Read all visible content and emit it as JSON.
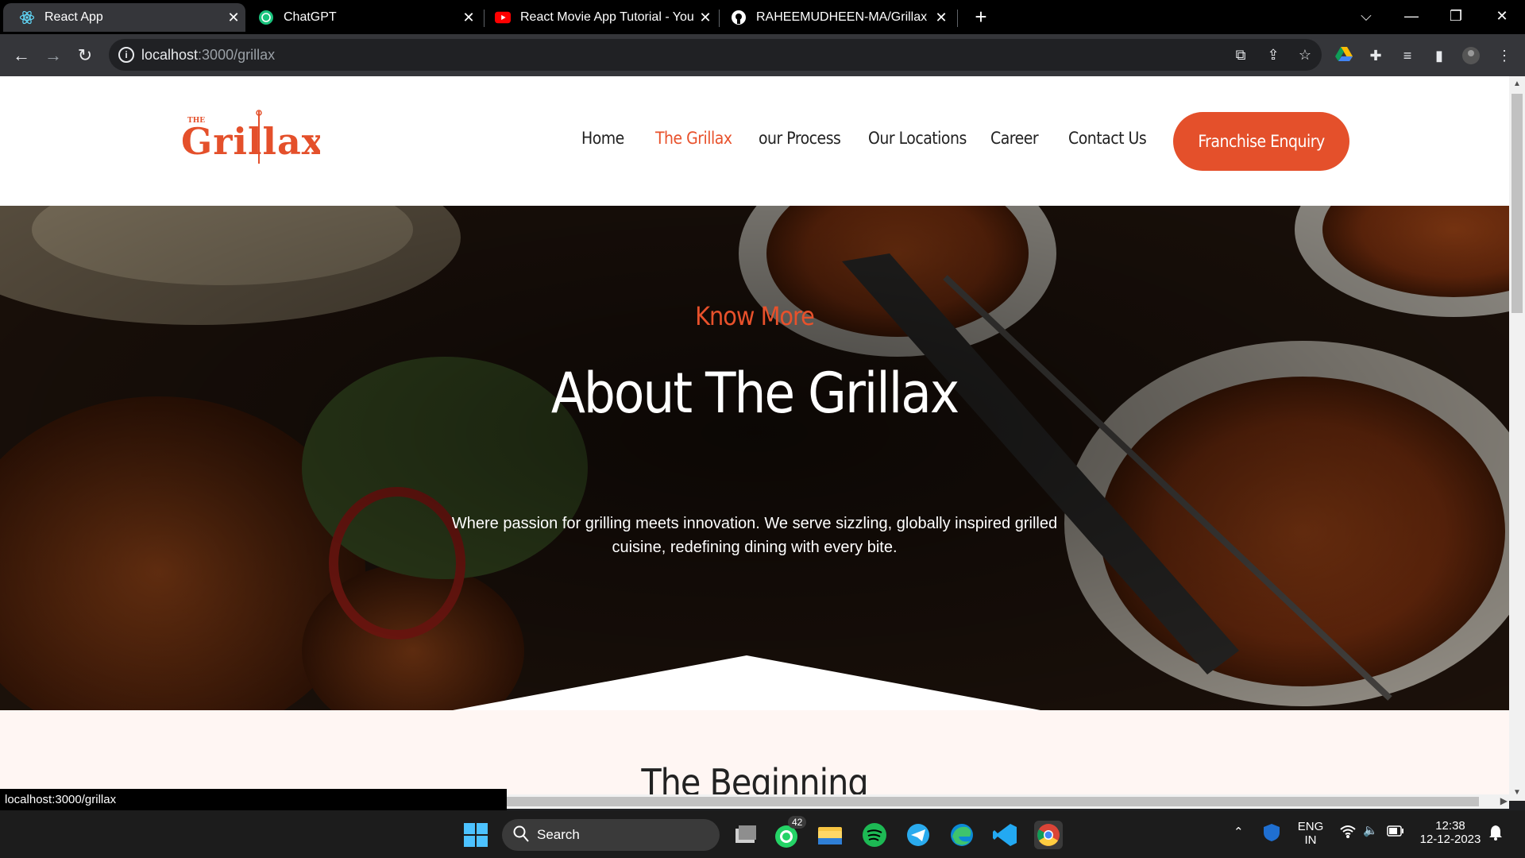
{
  "browser": {
    "tabs": [
      {
        "title": "React App",
        "icon": "react-icon",
        "active": true
      },
      {
        "title": "ChatGPT",
        "icon": "chatgpt-icon",
        "active": false
      },
      {
        "title": "React Movie App Tutorial - YouT",
        "icon": "youtube-icon",
        "active": false
      },
      {
        "title": "RAHEEMUDHEEN-MA/Grillax",
        "icon": "github-icon",
        "active": false
      }
    ],
    "new_tab": "+",
    "address": {
      "host": "localhost",
      "path": ":3000/grillax"
    },
    "status_url": "localhost:3000/grillax"
  },
  "site": {
    "logo": {
      "small": "THE",
      "main": "Grillax",
      "color": "#e4502b"
    },
    "nav": [
      {
        "label": "Home",
        "active": false
      },
      {
        "label": "The Grillax",
        "active": true
      },
      {
        "label": "our Process",
        "active": false
      },
      {
        "label": "Our Locations",
        "active": false
      },
      {
        "label": "Career",
        "active": false
      },
      {
        "label": "Contact Us",
        "active": false
      }
    ],
    "cta": "Franchise Enquiry",
    "accent": "#e4502b",
    "hero": {
      "kicker": "Know More",
      "title": "About The Grillax",
      "text": "Where passion for grilling meets innovation. We serve sizzling, globally inspired grilled cuisine, redefining dining with every bite."
    },
    "section2": {
      "title": "The Beginning",
      "background": "#fff6f3"
    }
  },
  "taskbar": {
    "search_label": "Search",
    "whatsapp_badge": "42",
    "lang": "ENG",
    "region": "IN",
    "time": "12:38",
    "date": "12-12-2023"
  }
}
